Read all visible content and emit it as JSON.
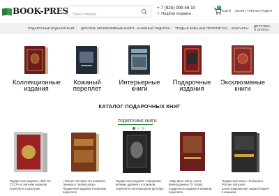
{
  "header": {
    "logo_text": "BOOK-PRESENT",
    "search_placeholder": "Поиск товаров",
    "phone": "+ 7 (925) 099 46 10",
    "pickup": "✓ Подбор подарка",
    "cart_count": "0",
    "cart_sum": "0.00 ₽",
    "login": "ЛОГИН / РЕГИСТРАЦИЯ"
  },
  "nav": {
    "items": [
      {
        "label": "ПОДАРОЧНЫЕ ИЗДАНИЯ КНИГ",
        "chevron": "⌄"
      },
      {
        "label": "ДОРОГИЕ ЭКСКЛЮЗИВНЫЕ КНИГИ",
        "chevron": "⌄"
      },
      {
        "label": "КНИЖНЫЙ ПОДАРОК",
        "chevron": "⌄"
      },
      {
        "label": "ТРУДЫ В КОЖАНЫХ ПЕРЕПЛЕТАХ",
        "chevron": "⌄"
      },
      {
        "label": "КОНТАКТЫ",
        "chevron": ""
      }
    ],
    "delivery_line1": "ДОСТАВКА",
    "delivery_line2": "И ОПЛАТА"
  },
  "carousel": {
    "categories": [
      {
        "label": "Коллекционные издания",
        "icon": "book-collectible"
      },
      {
        "label": "Кожаный переплет",
        "icon": "book-leather"
      },
      {
        "label": "Интерьерные книги",
        "icon": "book-hermitage"
      },
      {
        "label": "Подарочные издания",
        "icon": "book-gift"
      },
      {
        "label": "Эксклюзивные книги",
        "icon": "book-exclusive"
      }
    ],
    "active_dot": 0,
    "dots": 3
  },
  "catalog": {
    "title": "КАТАЛОГ ПОДАРОЧНЫХ КНИГ",
    "tab": "ПОДАРОЧНЫЕ КНИГИ",
    "products": [
      {
        "text": "Подарочное издание «100 лет СССР» в элитном кожаном переплете и шкатулке"
      },
      {
        "text": "«Теннис. История его развития, техника и тактика игры» Подарочное издание в кожаном переплете"
      },
      {
        "text": "Подарочное издание «Афоризмы великих древних» в кожаном переплете и интерьерном футляре"
      },
      {
        "text": "«Мир вина. Вина, сорта, виноградники» От Кларк, подарочное издание в кожаном переплете"
      },
      {
        "text": "Подарочная книга «Рыбалка в России. Большая иллюстрированная энциклопедия» в кожаном"
      }
    ]
  },
  "colors": {
    "accent_green": "#2f8a3b",
    "nav_bg": "#f0f0f0"
  }
}
